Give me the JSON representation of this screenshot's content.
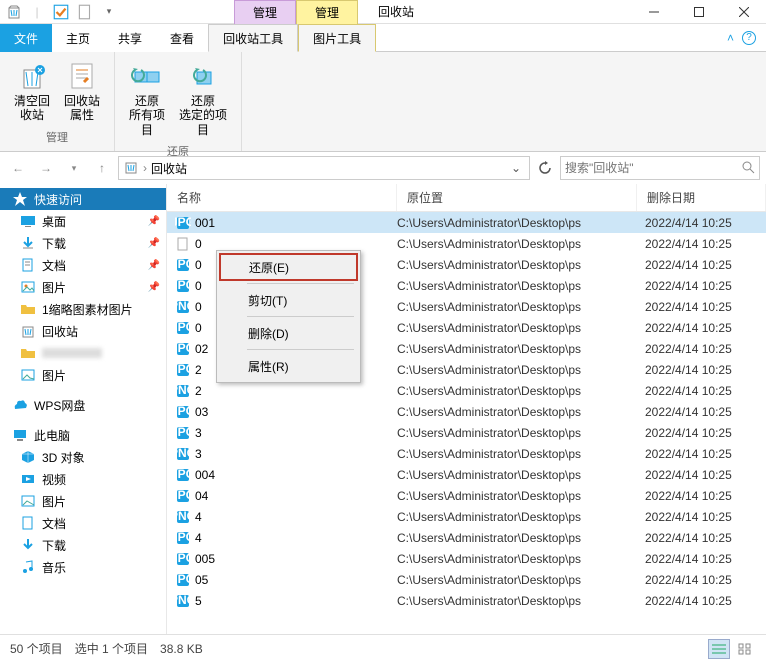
{
  "titlebar": {
    "tool_tab_1": "管理",
    "tool_tab_2": "管理",
    "window_title": "回收站"
  },
  "ribbon": {
    "tabs": {
      "file": "文件",
      "home": "主页",
      "share": "共享",
      "view": "查看",
      "recycle_tools": "回收站工具",
      "picture_tools": "图片工具"
    },
    "buttons": {
      "empty_bin": "清空回\n收站",
      "bin_props": "回收站\n属性",
      "restore_all": "还原\n所有项目",
      "restore_selected": "还原\n选定的项目"
    },
    "groups": {
      "manage": "管理",
      "restore": "还原"
    }
  },
  "addressbar": {
    "location": "回收站",
    "search_placeholder": "搜索\"回收站\""
  },
  "sidebar": {
    "quick_access": "快速访问",
    "desktop": "桌面",
    "downloads": "下载",
    "documents": "文档",
    "pictures": "图片",
    "thumbnails": "1缩略图素材图片",
    "recycle_bin": "回收站",
    "blurred": "",
    "pictures2": "图片",
    "wps": "WPS网盘",
    "this_pc": "此电脑",
    "objects_3d": "3D 对象",
    "videos": "视频",
    "pictures3": "图片",
    "documents2": "文档",
    "downloads2": "下载",
    "music": "音乐"
  },
  "columns": {
    "name": "名称",
    "original_location": "原位置",
    "date_deleted": "删除日期"
  },
  "files": [
    {
      "name": "001",
      "type": "jpg",
      "loc": "C:\\Users\\Administrator\\Desktop\\ps",
      "date": "2022/4/14 10:25"
    },
    {
      "name": "0",
      "type": "file",
      "loc": "C:\\Users\\Administrator\\Desktop\\ps",
      "date": "2022/4/14 10:25"
    },
    {
      "name": "0",
      "type": "jpg",
      "loc": "C:\\Users\\Administrator\\Desktop\\ps",
      "date": "2022/4/14 10:25"
    },
    {
      "name": "0",
      "type": "jpg",
      "loc": "C:\\Users\\Administrator\\Desktop\\ps",
      "date": "2022/4/14 10:25"
    },
    {
      "name": "0",
      "type": "png",
      "loc": "C:\\Users\\Administrator\\Desktop\\ps",
      "date": "2022/4/14 10:25"
    },
    {
      "name": "0",
      "type": "jpg",
      "loc": "C:\\Users\\Administrator\\Desktop\\ps",
      "date": "2022/4/14 10:25"
    },
    {
      "name": "02",
      "type": "jpg",
      "loc": "C:\\Users\\Administrator\\Desktop\\ps",
      "date": "2022/4/14 10:25"
    },
    {
      "name": "2",
      "type": "jpg",
      "loc": "C:\\Users\\Administrator\\Desktop\\ps",
      "date": "2022/4/14 10:25"
    },
    {
      "name": "2",
      "type": "png",
      "loc": "C:\\Users\\Administrator\\Desktop\\ps",
      "date": "2022/4/14 10:25"
    },
    {
      "name": "03",
      "type": "jpg",
      "loc": "C:\\Users\\Administrator\\Desktop\\ps",
      "date": "2022/4/14 10:25"
    },
    {
      "name": "3",
      "type": "jpg",
      "loc": "C:\\Users\\Administrator\\Desktop\\ps",
      "date": "2022/4/14 10:25"
    },
    {
      "name": "3",
      "type": "png",
      "loc": "C:\\Users\\Administrator\\Desktop\\ps",
      "date": "2022/4/14 10:25"
    },
    {
      "name": "004",
      "type": "jpg",
      "loc": "C:\\Users\\Administrator\\Desktop\\ps",
      "date": "2022/4/14 10:25"
    },
    {
      "name": "04",
      "type": "jpg",
      "loc": "C:\\Users\\Administrator\\Desktop\\ps",
      "date": "2022/4/14 10:25"
    },
    {
      "name": "4",
      "type": "png",
      "loc": "C:\\Users\\Administrator\\Desktop\\ps",
      "date": "2022/4/14 10:25"
    },
    {
      "name": "4",
      "type": "jpg",
      "loc": "C:\\Users\\Administrator\\Desktop\\ps",
      "date": "2022/4/14 10:25"
    },
    {
      "name": "005",
      "type": "jpg",
      "loc": "C:\\Users\\Administrator\\Desktop\\ps",
      "date": "2022/4/14 10:25"
    },
    {
      "name": "05",
      "type": "jpg",
      "loc": "C:\\Users\\Administrator\\Desktop\\ps",
      "date": "2022/4/14 10:25"
    },
    {
      "name": "5",
      "type": "png",
      "loc": "C:\\Users\\Administrator\\Desktop\\ps",
      "date": "2022/4/14 10:25"
    }
  ],
  "context_menu": {
    "restore": "还原(E)",
    "cut": "剪切(T)",
    "delete": "删除(D)",
    "properties": "属性(R)"
  },
  "statusbar": {
    "item_count": "50 个项目",
    "selected": "选中 1 个项目",
    "size": "38.8 KB"
  }
}
